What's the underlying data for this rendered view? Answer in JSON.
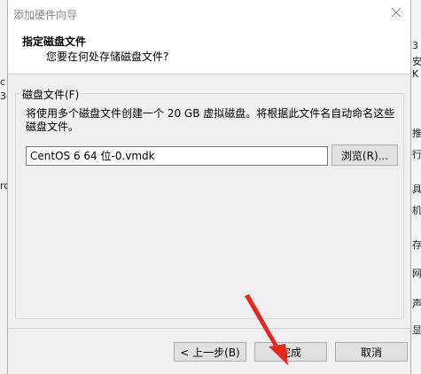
{
  "background": {
    "left_fragments": [
      "c",
      "3c",
      "rc"
    ],
    "right_fragments": [
      "3",
      "安",
      "K",
      "推",
      "行",
      "具",
      "机",
      "存",
      "网",
      "声",
      "显"
    ]
  },
  "dialog": {
    "title": "添加硬件向导",
    "header_title": "指定磁盘文件",
    "header_subtitle": "您要在何处存储磁盘文件?",
    "group_label": "磁盘文件(F)",
    "description": "将使用多个磁盘文件创建一个 20 GB 虚拟磁盘。将根据此文件名自动命名这些磁盘文件。",
    "file_path_value": "CentOS 6 64 位-0.vmdk",
    "browse_label": "浏览(R)...",
    "back_label": "< 上一步(B)",
    "finish_label": "完成",
    "cancel_label": "取消"
  },
  "colors": {
    "annotation_arrow": "#e8261b",
    "dialog_bg": "#f0f0f0",
    "button_bg": "#e1e1e1"
  },
  "icons": {
    "close": "close-icon"
  }
}
